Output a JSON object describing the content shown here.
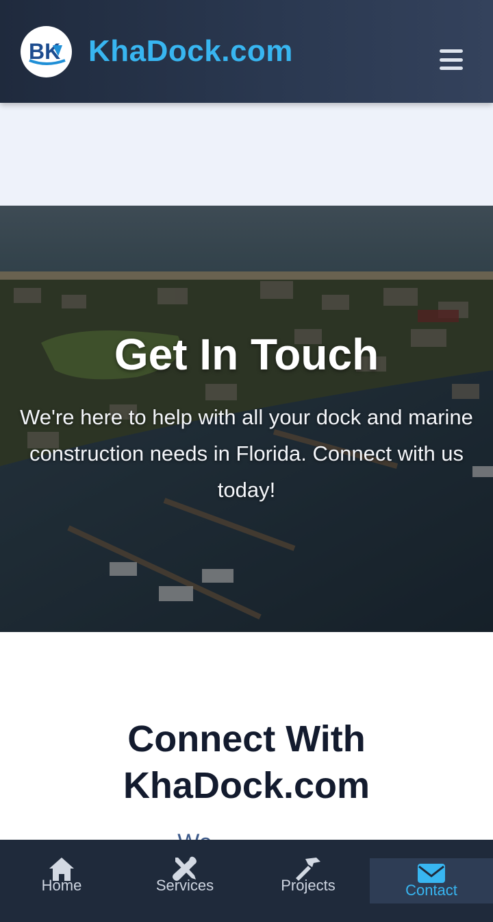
{
  "header": {
    "logo_text": "BK",
    "brand": "KhaDock.com"
  },
  "hero": {
    "title": "Get In Touch",
    "subtitle": "We're here to help with all your dock and marine construction needs in Florida. Connect with us today!"
  },
  "connect": {
    "title_line1": "Connect With",
    "title_line2": "KhaDock.com",
    "subtitle_partial": "We ... ... ... ..."
  },
  "bottom_nav": {
    "items": [
      {
        "label": "Home",
        "icon": "home-icon"
      },
      {
        "label": "Services",
        "icon": "tools-icon"
      },
      {
        "label": "Projects",
        "icon": "hammer-icon"
      },
      {
        "label": "Contact",
        "icon": "envelope-icon",
        "active": true
      }
    ]
  },
  "colors": {
    "brand_accent": "#38b6f1",
    "header_bg": "#26324a",
    "nav_bg": "#1f2a3b",
    "heading_text": "#131b2e"
  }
}
